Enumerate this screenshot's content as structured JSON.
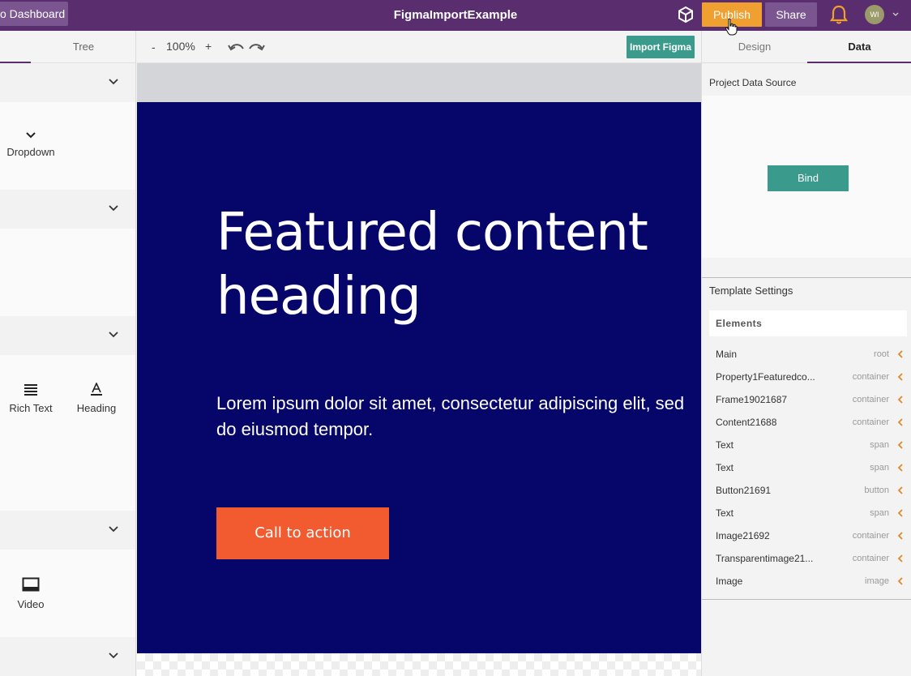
{
  "header": {
    "back_label": "o Dashboard",
    "title": "FigmaImportExample",
    "publish_label": "Publish",
    "share_label": "Share",
    "avatar_initials": "WI"
  },
  "left_panel": {
    "tab_tree": "Tree",
    "widgets": {
      "dropdown": "Dropdown",
      "rich_text": "Rich Text",
      "heading": "Heading",
      "video": "Video"
    }
  },
  "toolbar": {
    "zoom_minus": "-",
    "zoom_value": "100%",
    "zoom_plus": "+",
    "import_label": "Import Figma"
  },
  "canvas": {
    "heading": "Featured content heading",
    "text": "Lorem ipsum dolor sit amet, consectetur adipiscing elit, sed do eiusmod tempor.",
    "cta": "Call to action",
    "hero_color": "#05056a",
    "cta_color": "#f25a30"
  },
  "right_panel": {
    "tab_design": "Design",
    "tab_data": "Data",
    "project_data_source": "Project Data Source",
    "bind_label": "Bind",
    "template_settings": "Template Settings",
    "elements_label": "Elements",
    "elements": [
      {
        "name": "Main",
        "type": "root"
      },
      {
        "name": "Property1Featuredco...",
        "type": "container"
      },
      {
        "name": "Frame19021687",
        "type": "container"
      },
      {
        "name": "Content21688",
        "type": "container"
      },
      {
        "name": "Text",
        "type": "span"
      },
      {
        "name": "Text",
        "type": "span"
      },
      {
        "name": "Button21691",
        "type": "button"
      },
      {
        "name": "Text",
        "type": "span"
      },
      {
        "name": "Image21692",
        "type": "container"
      },
      {
        "name": "Transparentimage21...",
        "type": "container"
      },
      {
        "name": "Image",
        "type": "image"
      }
    ]
  },
  "colors": {
    "topbar": "#5a2d6e",
    "publish": "#f0a030",
    "teal": "#3a9a8c"
  }
}
